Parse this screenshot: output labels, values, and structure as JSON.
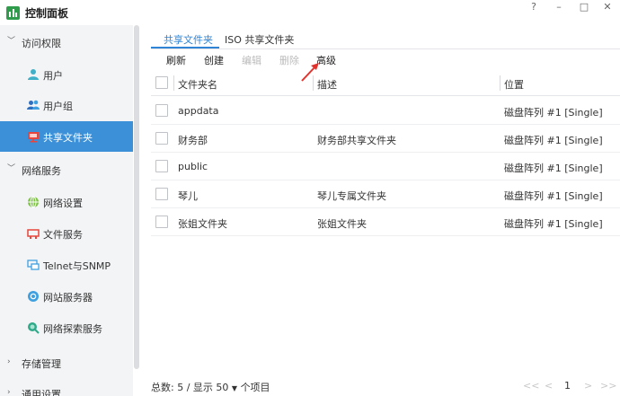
{
  "window": {
    "title": "控制面板",
    "help": "?",
    "minimize": "–",
    "maximize": "□",
    "close": "✕"
  },
  "sidebar": {
    "groups": [
      {
        "label": "访问权限",
        "expanded": true,
        "items": [
          {
            "label": "用户",
            "icon": "user-icon"
          },
          {
            "label": "用户组",
            "icon": "users-icon"
          },
          {
            "label": "共享文件夹",
            "icon": "shared-folder-icon",
            "active": true
          }
        ]
      },
      {
        "label": "网络服务",
        "expanded": true,
        "items": [
          {
            "label": "网络设置",
            "icon": "globe-icon"
          },
          {
            "label": "文件服务",
            "icon": "file-service-icon"
          },
          {
            "label": "Telnet与SNMP",
            "icon": "monitor-icon"
          },
          {
            "label": "网站服务器",
            "icon": "web-server-icon"
          },
          {
            "label": "网络探索服务",
            "icon": "network-discovery-icon"
          }
        ]
      },
      {
        "label": "存储管理",
        "expanded": false,
        "items": []
      },
      {
        "label": "通用设置",
        "expanded": false,
        "items": []
      }
    ]
  },
  "tabs": [
    {
      "label": "共享文件夹",
      "active": true
    },
    {
      "label": "ISO 共享文件夹",
      "active": false
    }
  ],
  "toolbar": {
    "refresh": "刷新",
    "create": "创建",
    "edit": "编辑",
    "delete": "删除",
    "advanced": "高级"
  },
  "table": {
    "columns": [
      "文件夹名",
      "描述",
      "位置"
    ],
    "rows": [
      {
        "name": "appdata",
        "desc": "",
        "location": "磁盘阵列 #1 [Single]"
      },
      {
        "name": "财务部",
        "desc": "财务部共享文件夹",
        "location": "磁盘阵列 #1 [Single]"
      },
      {
        "name": "public",
        "desc": "",
        "location": "磁盘阵列 #1 [Single]"
      },
      {
        "name": "琴儿",
        "desc": "琴儿专属文件夹",
        "location": "磁盘阵列 #1 [Single]"
      },
      {
        "name": "张姐文件夹",
        "desc": "张姐文件夹",
        "location": "磁盘阵列 #1 [Single]"
      }
    ]
  },
  "footer": {
    "summary": "总数: 5 / 显示",
    "page_size": "50",
    "unit": "个项目",
    "first": "<<",
    "prev": "<",
    "page": "1",
    "next": ">",
    "last": ">>"
  },
  "colors": {
    "accent": "#2f84d6",
    "active_item_bg": "#3c90d8",
    "sidebar_bg": "#f3f4f6",
    "annotation_arrow": "#e0332e"
  }
}
